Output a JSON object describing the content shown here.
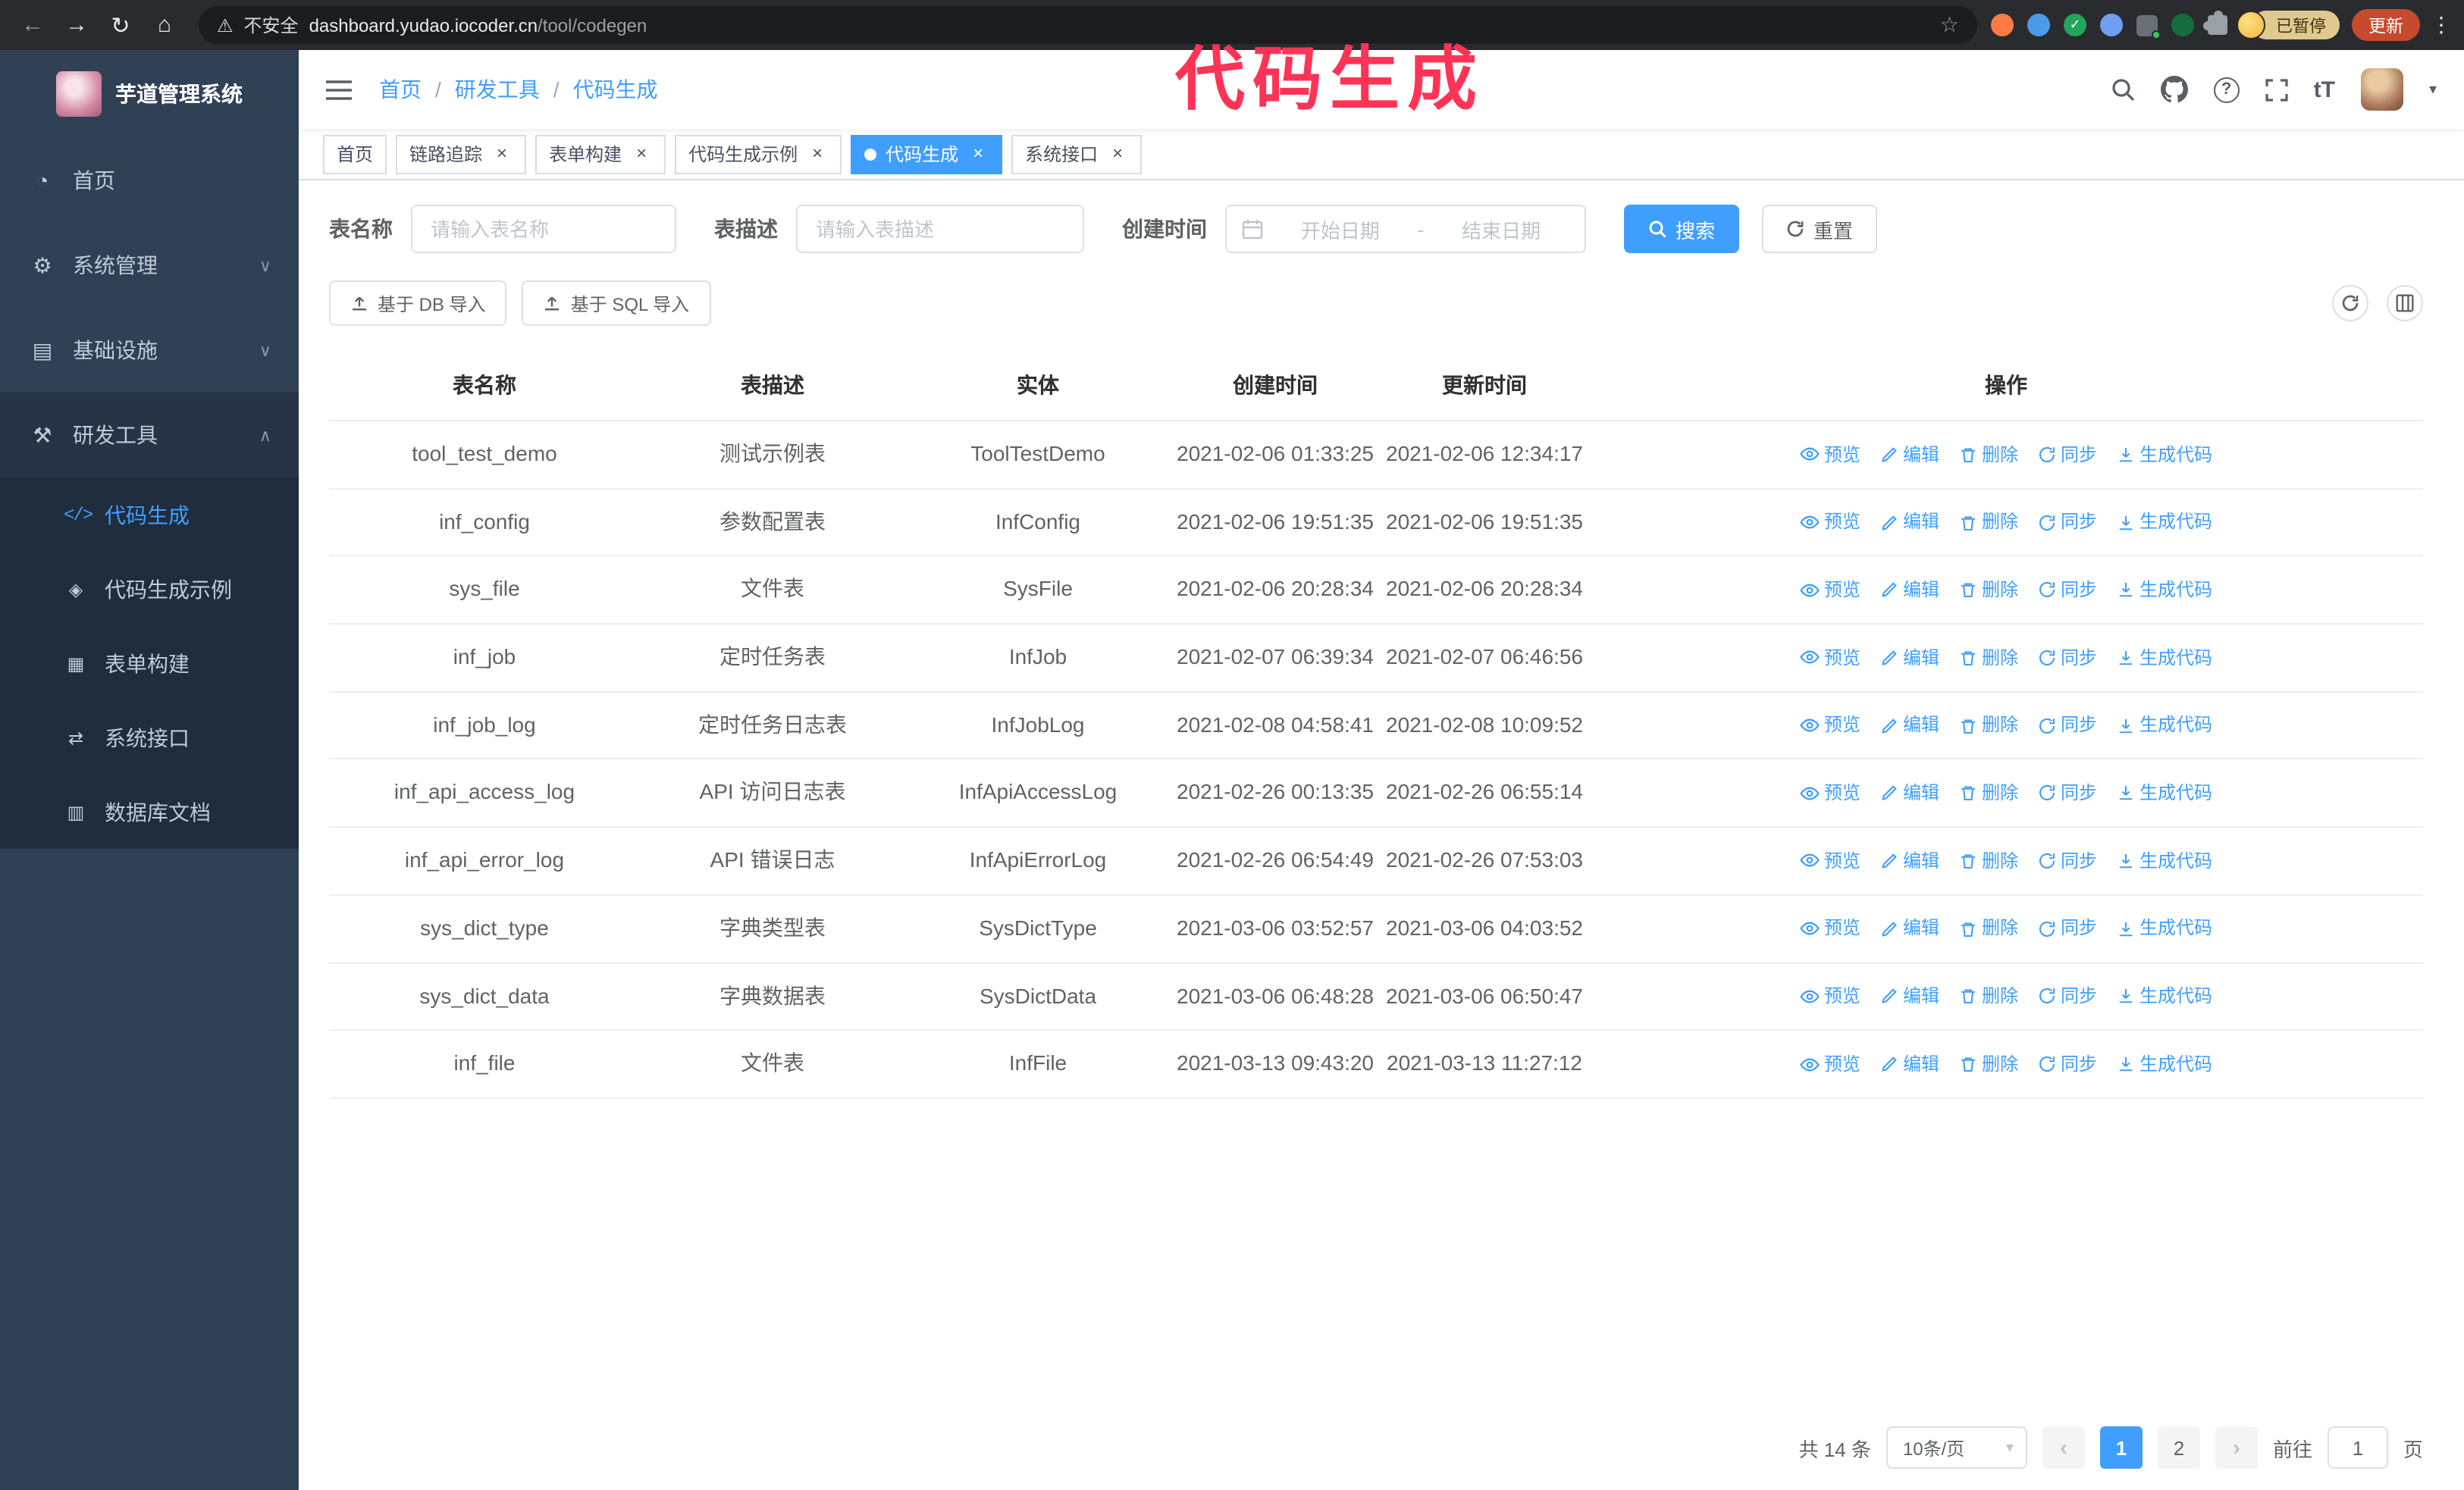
{
  "colors": {
    "primary": "#409eff",
    "sidebar_bg": "#304156",
    "submenu_bg": "#1f2d3d",
    "tab_active_bg": "#409eff",
    "annotation": "#ff3355",
    "update_button_bg": "#c64a2e",
    "paused_badge_bg": "#dfc98e"
  },
  "browser": {
    "security_label": "不安全",
    "url_host": "dashboard.yudao.iocoder.cn",
    "url_path": "/tool/codegen",
    "paused_badge": "已暂停",
    "update_button": "更新"
  },
  "annotation": {
    "text": "代码生成"
  },
  "sidebar": {
    "logo_title": "芋道管理系统",
    "items": [
      {
        "label": "首页"
      },
      {
        "label": "系统管理"
      },
      {
        "label": "基础设施"
      },
      {
        "label": "研发工具"
      }
    ],
    "subitems": [
      {
        "label": "代码生成",
        "active": true
      },
      {
        "label": "代码生成示例"
      },
      {
        "label": "表单构建"
      },
      {
        "label": "系统接口"
      },
      {
        "label": "数据库文档"
      }
    ]
  },
  "header": {
    "breadcrumb": [
      "首页",
      "研发工具",
      "代码生成"
    ]
  },
  "tabs": [
    {
      "label": "首页",
      "closable": false,
      "active": false
    },
    {
      "label": "链路追踪",
      "closable": true,
      "active": false
    },
    {
      "label": "表单构建",
      "closable": true,
      "active": false
    },
    {
      "label": "代码生成示例",
      "closable": true,
      "active": false
    },
    {
      "label": "代码生成",
      "closable": true,
      "active": true
    },
    {
      "label": "系统接口",
      "closable": true,
      "active": false
    }
  ],
  "filters": {
    "table_name_label": "表名称",
    "table_name_placeholder": "请输入表名称",
    "table_desc_label": "表描述",
    "table_desc_placeholder": "请输入表描述",
    "create_time_label": "创建时间",
    "date_start_placeholder": "开始日期",
    "date_separator": "-",
    "date_end_placeholder": "结束日期",
    "search_button": "搜索",
    "reset_button": "重置"
  },
  "toolbar": {
    "import_db_button": "基于 DB 导入",
    "import_sql_button": "基于 SQL 导入"
  },
  "table": {
    "columns": [
      "表名称",
      "表描述",
      "实体",
      "创建时间",
      "更新时间",
      "操作"
    ],
    "ops": [
      "预览",
      "编辑",
      "删除",
      "同步",
      "生成代码"
    ],
    "rows": [
      {
        "name": "tool_test_demo",
        "desc": "测试示例表",
        "entity": "ToolTestDemo",
        "created": "2021-02-06 01:33:25",
        "updated": "2021-02-06 12:34:17"
      },
      {
        "name": "inf_config",
        "desc": "参数配置表",
        "entity": "InfConfig",
        "created": "2021-02-06 19:51:35",
        "updated": "2021-02-06 19:51:35"
      },
      {
        "name": "sys_file",
        "desc": "文件表",
        "entity": "SysFile",
        "created": "2021-02-06 20:28:34",
        "updated": "2021-02-06 20:28:34"
      },
      {
        "name": "inf_job",
        "desc": "定时任务表",
        "entity": "InfJob",
        "created": "2021-02-07 06:39:34",
        "updated": "2021-02-07 06:46:56"
      },
      {
        "name": "inf_job_log",
        "desc": "定时任务日志表",
        "entity": "InfJobLog",
        "created": "2021-02-08 04:58:41",
        "updated": "2021-02-08 10:09:52"
      },
      {
        "name": "inf_api_access_log",
        "desc": "API 访问日志表",
        "entity": "InfApiAccessLog",
        "created": "2021-02-26 00:13:35",
        "updated": "2021-02-26 06:55:14"
      },
      {
        "name": "inf_api_error_log",
        "desc": "API 错误日志",
        "entity": "InfApiErrorLog",
        "created": "2021-02-26 06:54:49",
        "updated": "2021-02-26 07:53:03"
      },
      {
        "name": "sys_dict_type",
        "desc": "字典类型表",
        "entity": "SysDictType",
        "created": "2021-03-06 03:52:57",
        "updated": "2021-03-06 04:03:52"
      },
      {
        "name": "sys_dict_data",
        "desc": "字典数据表",
        "entity": "SysDictData",
        "created": "2021-03-06 06:48:28",
        "updated": "2021-03-06 06:50:47"
      },
      {
        "name": "inf_file",
        "desc": "文件表",
        "entity": "InfFile",
        "created": "2021-03-13 09:43:20",
        "updated": "2021-03-13 11:27:12"
      }
    ]
  },
  "pagination": {
    "total_text": "共 14 条",
    "page_size": "10条/页",
    "pages": [
      "1",
      "2"
    ],
    "active_page": "1",
    "goto_label": "前往",
    "goto_value": "1",
    "goto_suffix": "页"
  },
  "icons": {
    "back": "←",
    "forward": "→",
    "reload": "↻",
    "home": "⌂",
    "warning": "⚠",
    "star": "☆",
    "kebab": "⋮",
    "check": "✓",
    "menu_home": "◔",
    "menu_system": "⚙",
    "menu_infra": "▤",
    "menu_tools": "⚒",
    "menu_code": "</>",
    "menu_example": "◈",
    "menu_form": "▦",
    "menu_api": "⇄",
    "menu_db": "▥",
    "chevron_down": "∨",
    "chevron_up": "∧",
    "question": "?",
    "font_size": "tT",
    "caret_down": "▾",
    "close": "×",
    "slash": "/",
    "prev": "‹",
    "next": "›"
  }
}
